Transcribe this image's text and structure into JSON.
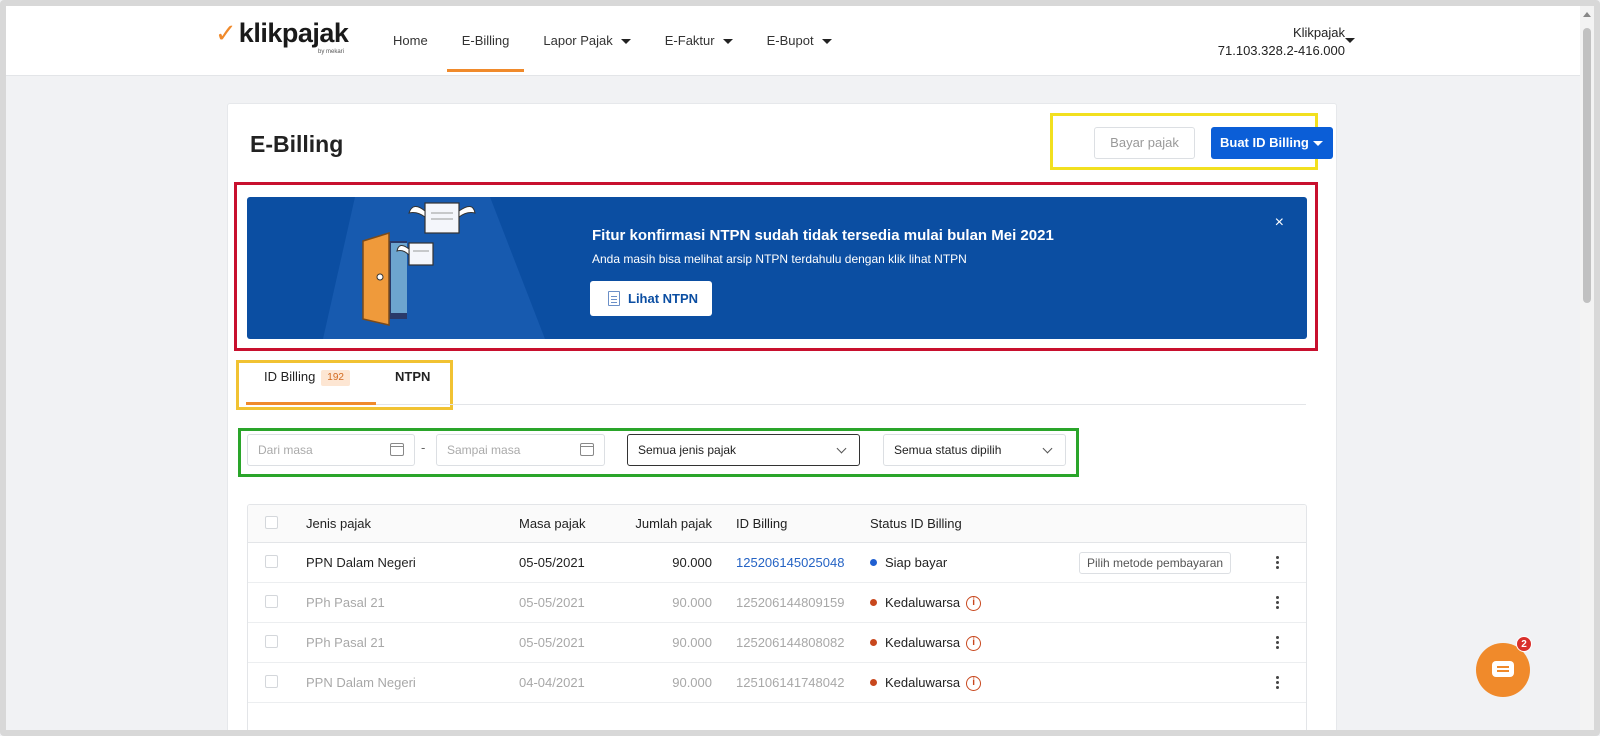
{
  "app": {
    "logo_text": "klikpajak",
    "logo_sub": "by mekari",
    "accent_color": "#f08a2b",
    "primary_color": "#0b5ed7"
  },
  "nav": {
    "items": [
      {
        "label": "Home",
        "active": false,
        "dropdown": false
      },
      {
        "label": "E-Billing",
        "active": true,
        "dropdown": false
      },
      {
        "label": "Lapor Pajak",
        "active": false,
        "dropdown": true
      },
      {
        "label": "E-Faktur",
        "active": false,
        "dropdown": true
      },
      {
        "label": "E-Bupot",
        "active": false,
        "dropdown": true
      }
    ]
  },
  "account": {
    "name": "Klikpajak",
    "npwp": "71.103.328.2-416.000"
  },
  "page": {
    "title": "E-Billing",
    "bayar_label": "Bayar pajak",
    "buat_label": "Buat ID Billing"
  },
  "banner": {
    "title": "Fitur konfirmasi NTPN sudah tidak tersedia mulai bulan Mei 2021",
    "subtitle": "Anda masih bisa melihat arsip NTPN terdahulu dengan klik lihat NTPN",
    "button_label": "Lihat NTPN",
    "close_glyph": "×",
    "background_color": "#0b4ea2"
  },
  "tabs": {
    "billing_label": "ID Billing",
    "billing_count": "192",
    "ntpn_label": "NTPN"
  },
  "filters": {
    "from_placeholder": "Dari masa",
    "to_placeholder": "Sampai masa",
    "separator": "-",
    "type_value": "Semua jenis pajak",
    "status_value": "Semua status dipilih"
  },
  "table": {
    "headers": {
      "jenis": "Jenis pajak",
      "masa": "Masa pajak",
      "jumlah": "Jumlah pajak",
      "id": "ID Billing",
      "status": "Status ID Billing"
    },
    "rows": [
      {
        "jenis": "PPN Dalam Negeri",
        "masa": "05-05/2021",
        "jumlah": "90.000",
        "id": "125206145025048",
        "status": "Siap bayar",
        "status_color": "#1f5fd1",
        "action": "Pilih metode pembayaran"
      },
      {
        "jenis": "PPh Pasal 21",
        "masa": "05-05/2021",
        "jumlah": "90.000",
        "id": "125206144809159",
        "status": "Kedaluwarsa",
        "status_color": "#c8471d",
        "info": "i"
      },
      {
        "jenis": "PPh Pasal 21",
        "masa": "05-05/2021",
        "jumlah": "90.000",
        "id": "125206144808082",
        "status": "Kedaluwarsa",
        "status_color": "#c8471d",
        "info": "i"
      },
      {
        "jenis": "PPN Dalam Negeri",
        "masa": "04-04/2021",
        "jumlah": "90.000",
        "id": "125106141748042",
        "status": "Kedaluwarsa",
        "status_color": "#c8471d",
        "info": "i"
      }
    ]
  },
  "chat": {
    "badge_count": "2"
  }
}
